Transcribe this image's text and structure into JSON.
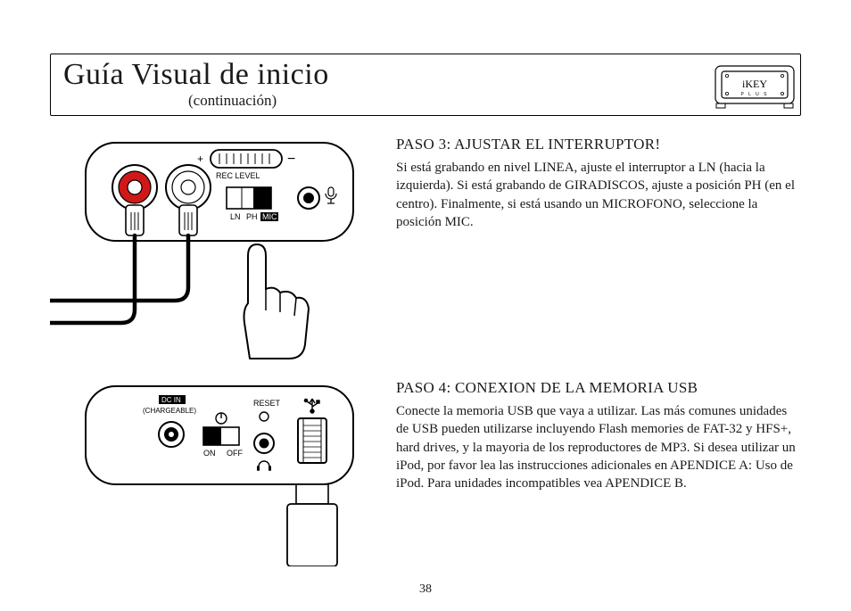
{
  "header": {
    "title": "Guía Visual de inicio",
    "subtitle": "(continuación)"
  },
  "steps": [
    {
      "heading": "PASO 3: AJUSTAR EL INTERRUPTOR!",
      "body": "Si está grabando en nivel LINEA, ajuste el interruptor a LN (hacia la izquierda). Si está grabando de GIRADISCOS, ajuste a posición PH (en el centro).  Finalmente, si está usando un MICROFONO, seleccione la posición MIC."
    },
    {
      "heading": "PASO 4: CONEXION DE LA MEMORIA USB",
      "body": "Conecte la memoria USB que vaya a utilizar.  Las más comunes unidades de USB pueden utilizarse incluyendo Flash memories de FAT-32 y HFS+, hard drives, y la mayoria de los reproductores de MP3.  Si desea utilizar un iPod, por favor lea las instrucciones adicionales en APENDICE A: Uso de iPod.  Para unidades incompatibles vea APENDICE B."
    }
  ],
  "labels": {
    "rec_level": "REC LEVEL",
    "ln": "LN",
    "ph": "PH",
    "mic": "MIC",
    "dc_in": "DC IN",
    "chargeable": "(CHARGEABLE)",
    "reset": "RESET",
    "on": "ON",
    "off": "OFF"
  },
  "logo": {
    "brand": "iKEY",
    "sub": "P L U S"
  },
  "page_number": "38"
}
